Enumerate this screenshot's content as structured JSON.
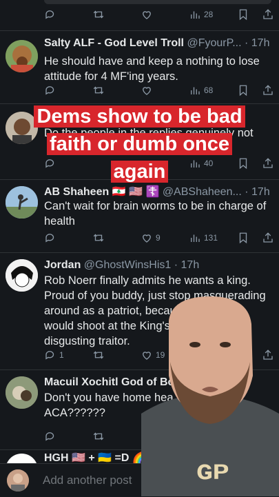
{
  "top_bar": {
    "views": "28"
  },
  "tweets": [
    {
      "name": "Salty ALF - God Level Troll",
      "handle": "@FyourP...",
      "time": "· 17h",
      "text": "He should have and keep a nothing to lose attitude for 4 MF'ing years.",
      "views": "68"
    },
    {
      "name": "",
      "handle": "",
      "time": "",
      "text": "Do the people in the replies genuinely not",
      "views": "40"
    },
    {
      "name": "AB Shaheen",
      "flags": "🇱🇧 🇺🇸 ☦️",
      "handle": "@ABShaheen...",
      "time": "· 17h",
      "text": "Can't wait for brain worms to be in charge of health",
      "likes": "9",
      "views": "131"
    },
    {
      "name": "Jordan",
      "handle": "@GhostWinsHis1",
      "time": "· 17h",
      "text_lines": [
        "Rob Noerr finally admits he wants a king.",
        "Proud of you buddy, just stop masquerading",
        "around as a patriot, because     ots",
        "would shoot at the King's f          a",
        "disgusting traitor."
      ],
      "replies": "1",
      "likes": "19"
    },
    {
      "name": "Macuil Xochitl God of Bo",
      "handle": "",
      "time": "",
      "text_lines": [
        "Don't you have home hea",
        "ACA??????"
      ]
    },
    {
      "name": "HGH 🇺🇸 + 🇺🇦 =D 🌈"
    }
  ],
  "caption_lines": [
    "Dems show to be bad",
    "faith or dumb once",
    "again"
  ],
  "compose": {
    "placeholder": "Add another post"
  },
  "colors": {
    "background": "#15181c",
    "text": "#e7e9ea",
    "muted": "#8b98a5",
    "caption_bg": "#d8262c"
  }
}
